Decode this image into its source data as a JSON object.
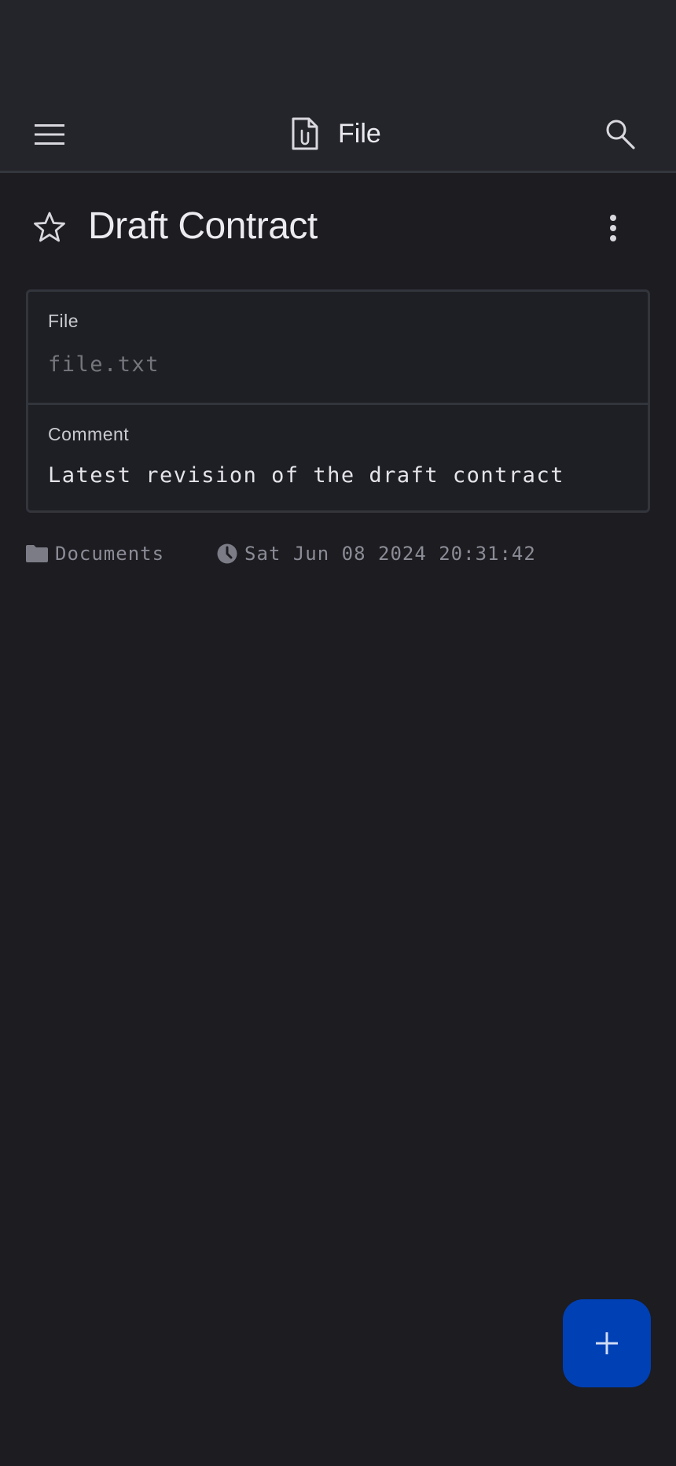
{
  "appbar": {
    "title": "File",
    "menu_icon": "hamburger-menu-icon",
    "title_icon": "file-attachment-icon",
    "search_icon": "search-icon"
  },
  "note": {
    "title": "Draft Contract",
    "starred": false
  },
  "fields": {
    "file": {
      "label": "File",
      "placeholder": "file.txt"
    },
    "comment": {
      "label": "Comment",
      "value": "Latest revision of the draft contract"
    }
  },
  "meta": {
    "folder": "Documents",
    "date": "Sat Jun 08 2024 20:31:42"
  },
  "fab": {
    "icon": "plus-icon"
  },
  "colors": {
    "background": "#1c1c21",
    "appbar": "#24252b",
    "accent": "#0040b5"
  }
}
